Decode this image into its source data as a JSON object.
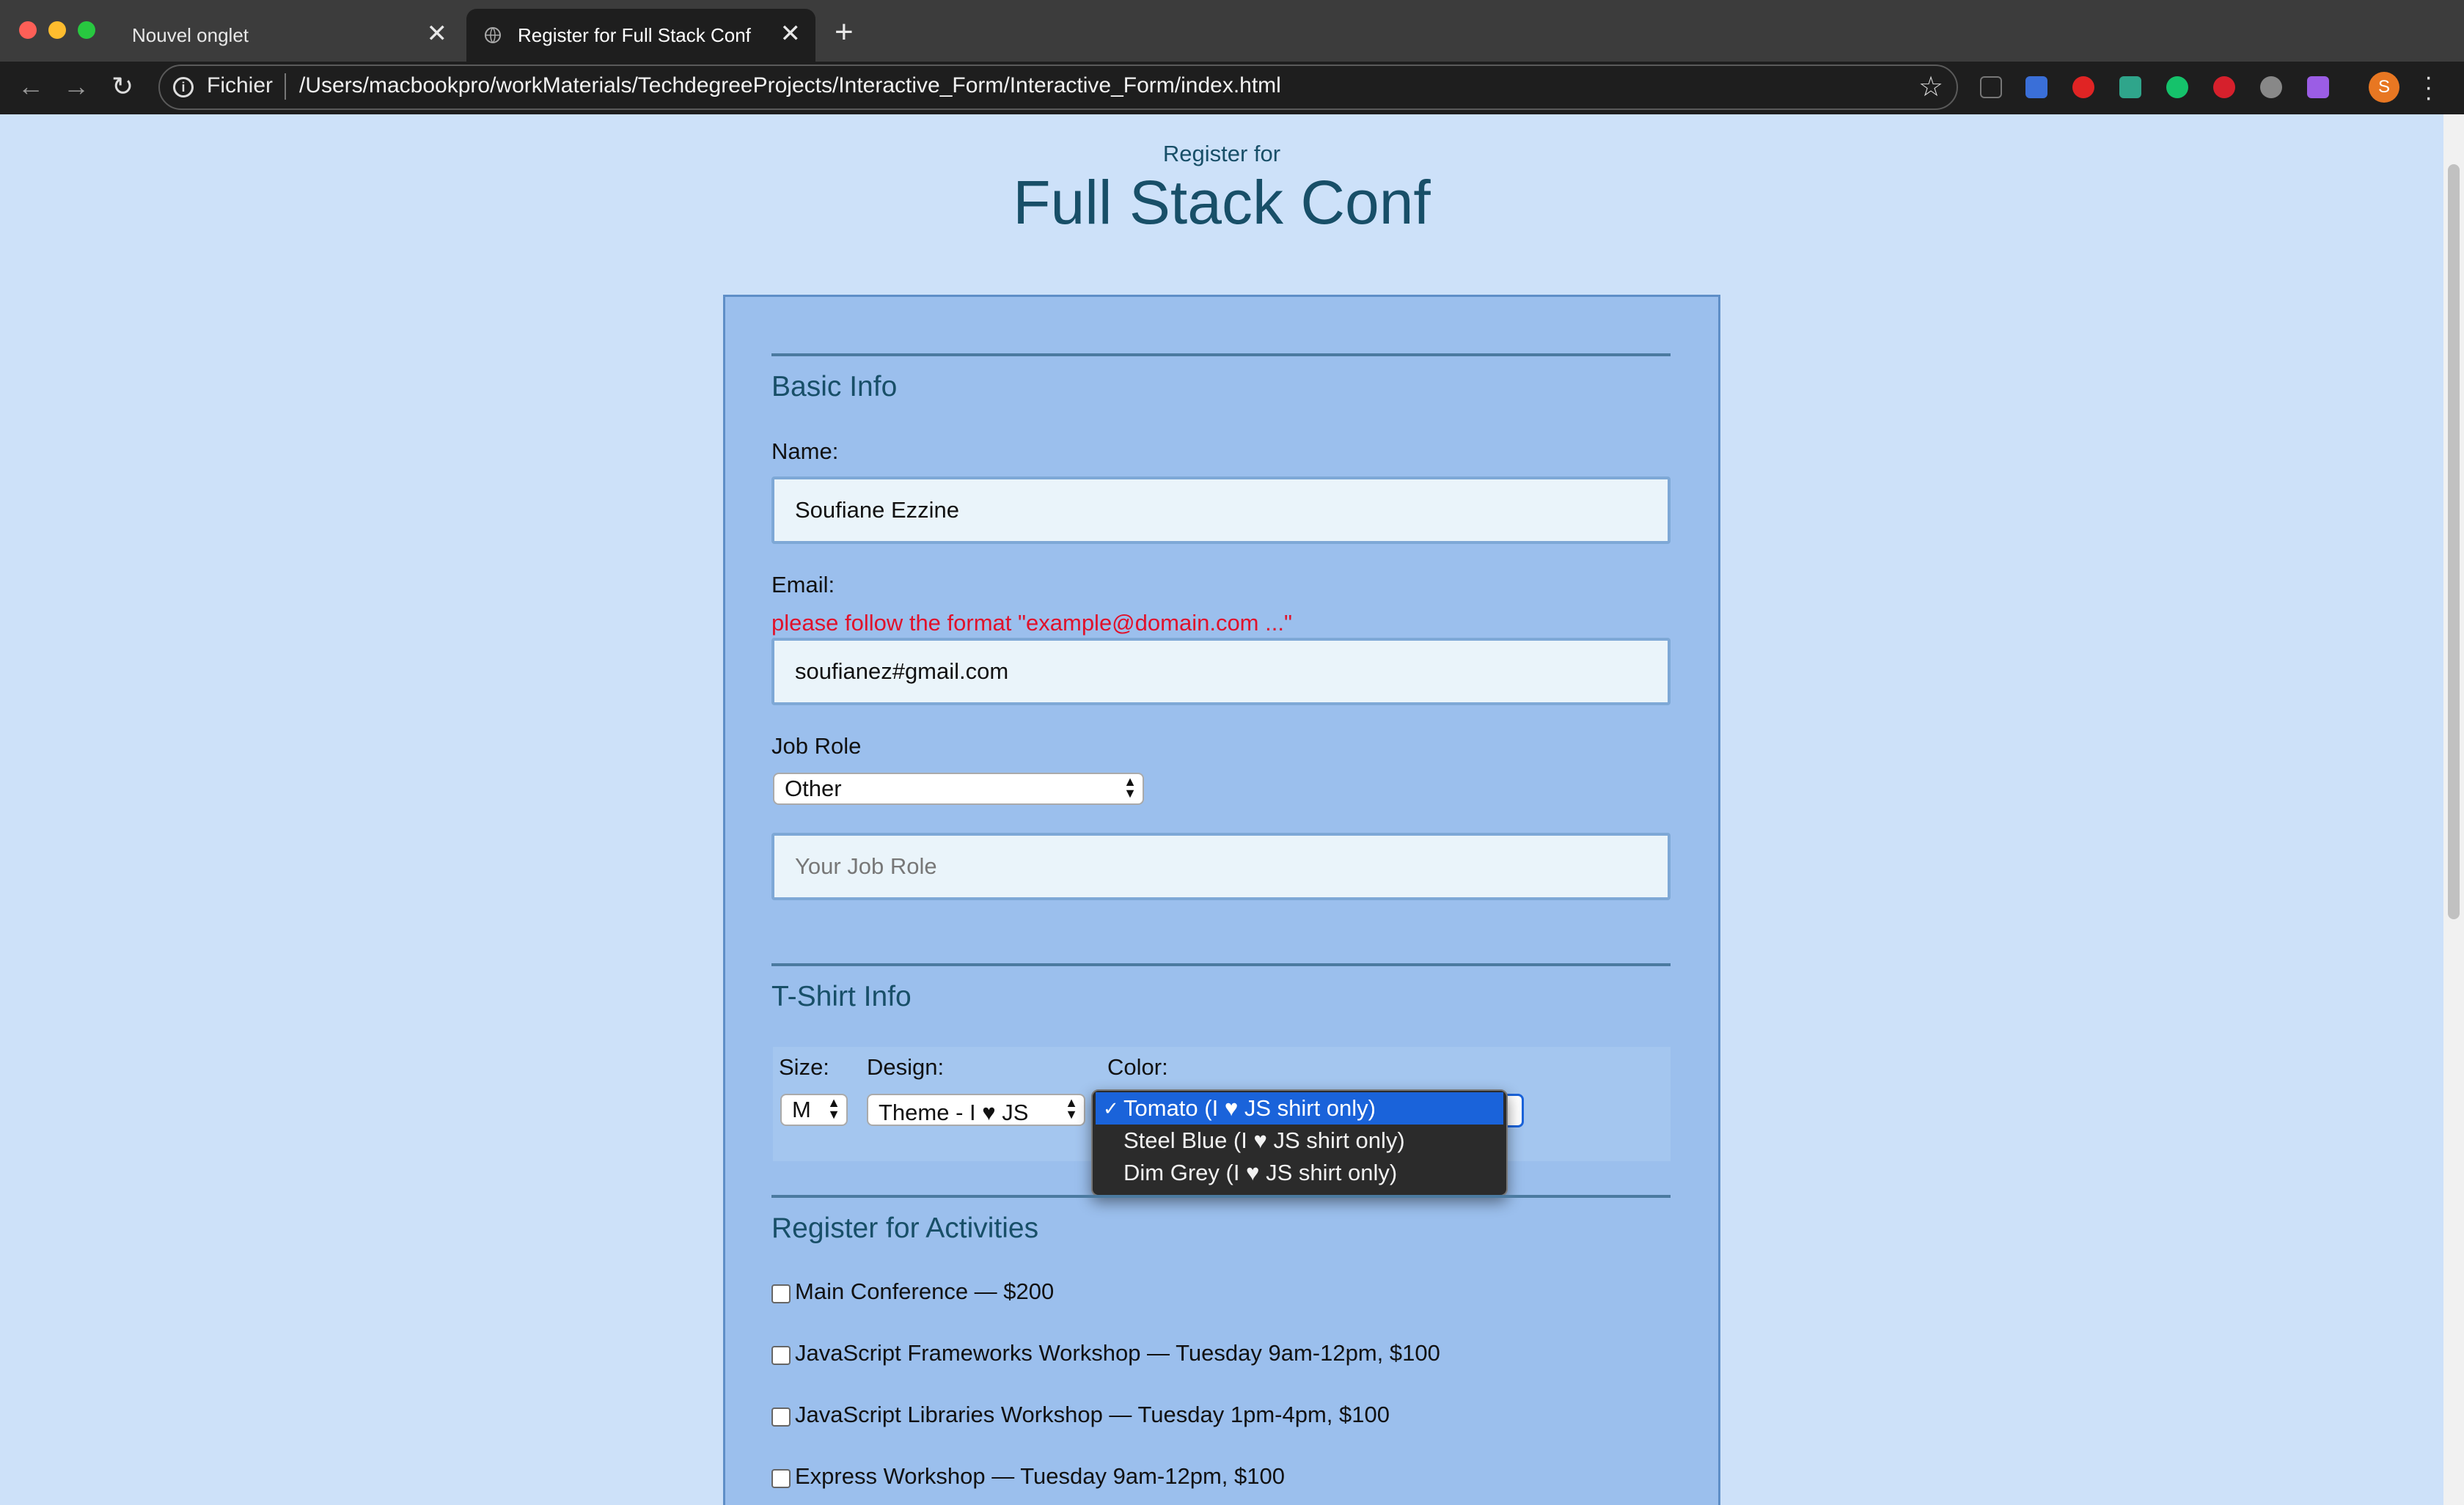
{
  "browser": {
    "tabs": [
      {
        "title": "Nouvel onglet",
        "active": false
      },
      {
        "title": "Register for Full Stack Conf",
        "active": true
      }
    ],
    "new_tab": "+",
    "omnibox": {
      "security_label": "Fichier",
      "url": "/Users/macbookpro/workMaterials/TechdegreeProjects/Interactive_Form/Interactive_Form/index.html"
    },
    "profile_initial": "S"
  },
  "header": {
    "pre_title": "Register for",
    "title": "Full Stack Conf"
  },
  "basic_info": {
    "title": "Basic Info",
    "name_label": "Name:",
    "name_value": "Soufiane Ezzine",
    "email_label": "Email:",
    "email_error": "please follow the format \"example@domain.com ...\"",
    "email_value": "soufianez#gmail.com",
    "job_role_label": "Job Role",
    "job_role_value": "Other",
    "job_role_placeholder": "Your Job Role"
  },
  "tshirt": {
    "title": "T-Shirt Info",
    "size_label": "Size:",
    "size_value": "M",
    "design_label": "Design:",
    "design_value": "Theme - I ♥ JS",
    "color_label": "Color:",
    "color_options": [
      {
        "label": "Tomato (I ♥ JS shirt only)",
        "selected": true
      },
      {
        "label": "Steel Blue (I ♥ JS shirt only)",
        "selected": false
      },
      {
        "label": "Dim Grey (I ♥ JS shirt only)",
        "selected": false
      }
    ]
  },
  "activities": {
    "title": "Register for Activities",
    "items": [
      "Main Conference — $200",
      "JavaScript Frameworks Workshop — Tuesday 9am-12pm, $100",
      "JavaScript Libraries Workshop — Tuesday 1pm-4pm, $100",
      "Express Workshop — Tuesday 9am-12pm, $100"
    ]
  },
  "colors": {
    "page_bg": "#cde1f9",
    "form_bg": "#9bbfed",
    "heading": "#184f68",
    "error": "#e0112a",
    "dropdown_highlight": "#1a63da"
  }
}
